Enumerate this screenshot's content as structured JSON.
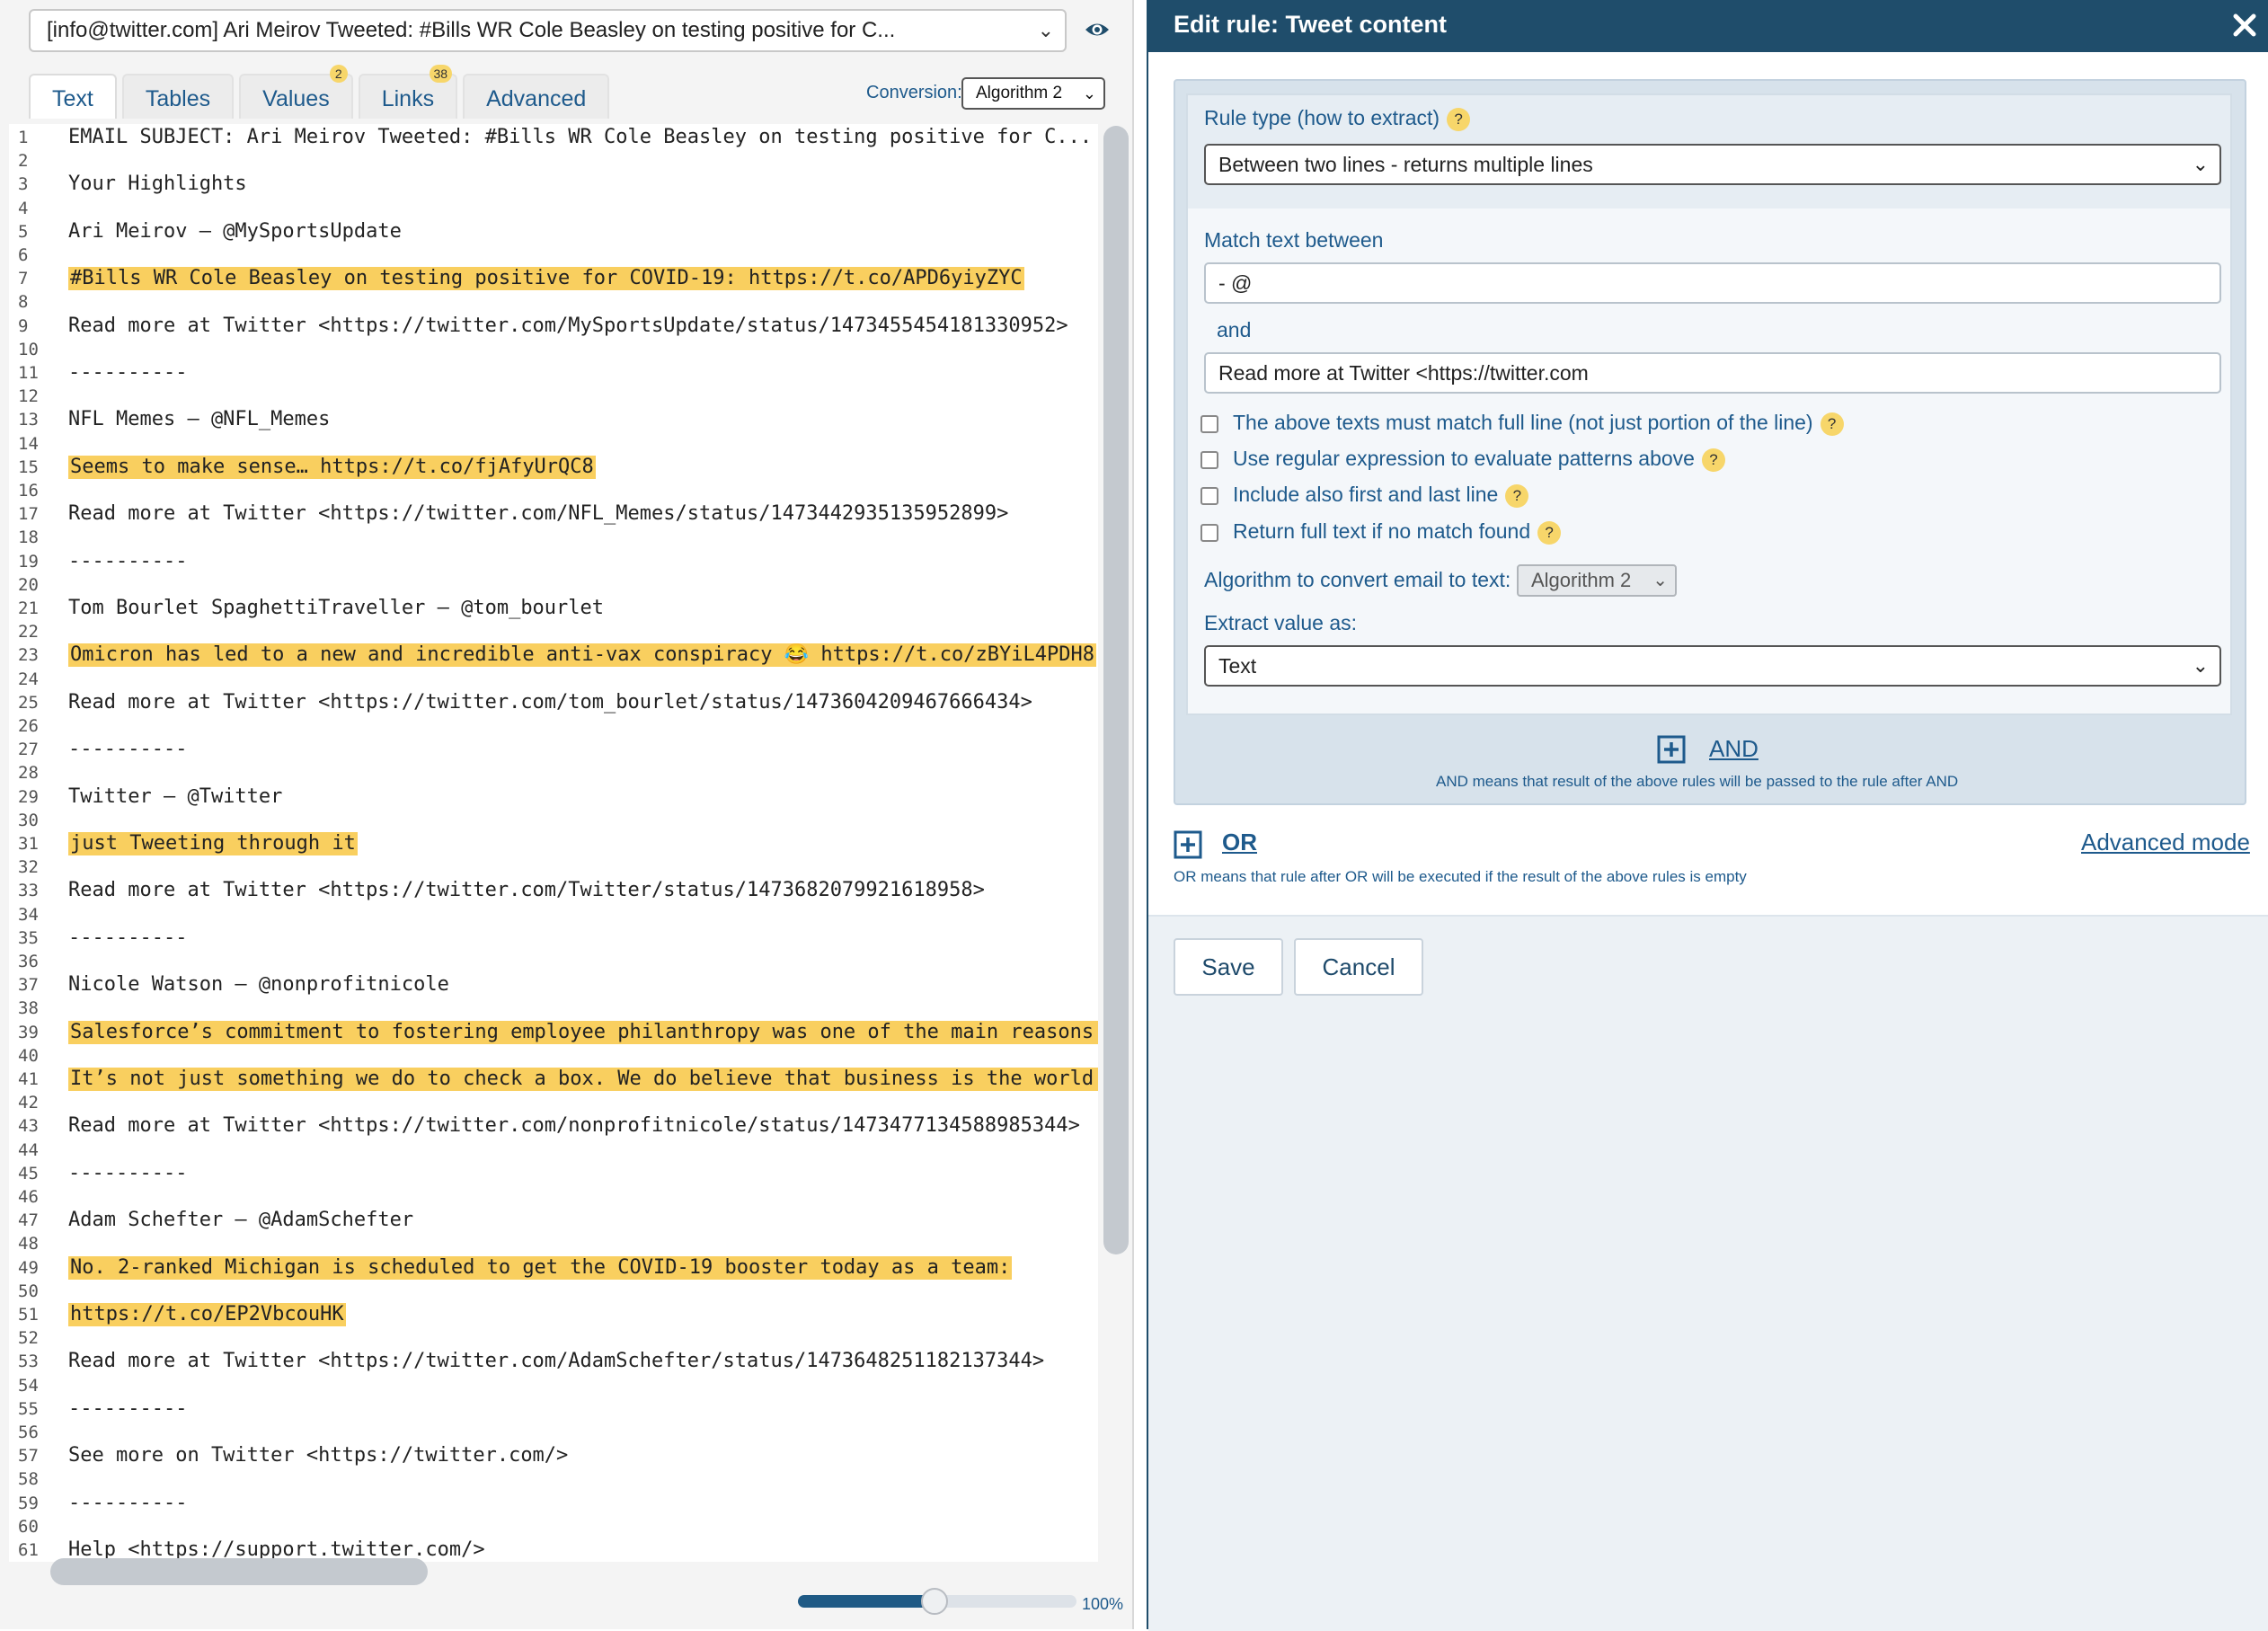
{
  "left": {
    "email_select": "[info@twitter.com] Ari Meirov Tweeted: #Bills WR Cole Beasley on testing positive for C...",
    "tabs": [
      {
        "label": "Text",
        "badge": ""
      },
      {
        "label": "Tables",
        "badge": ""
      },
      {
        "label": "Values",
        "badge": "2"
      },
      {
        "label": "Links",
        "badge": "38"
      },
      {
        "label": "Advanced",
        "badge": ""
      }
    ],
    "conversion_label": "Conversion:",
    "conversion_value": "Algorithm 2",
    "zoom_label": "100%",
    "zoom_level_percent": 50,
    "lines": [
      {
        "n": "1",
        "t": "EMAIL SUBJECT: Ari Meirov Tweeted: #Bills WR Cole Beasley on testing positive for C...",
        "hl": false
      },
      {
        "n": "2",
        "t": "",
        "hl": false
      },
      {
        "n": "3",
        "t": "Your Highlights",
        "hl": false
      },
      {
        "n": "4",
        "t": "",
        "hl": false
      },
      {
        "n": "5",
        "t": "Ari Meirov – @MySportsUpdate",
        "hl": false
      },
      {
        "n": "6",
        "t": "",
        "hl": false
      },
      {
        "n": "7",
        "t": "#Bills WR Cole Beasley on testing positive for COVID-19: https://t.co/APD6yiyZYC",
        "hl": true
      },
      {
        "n": "8",
        "t": "",
        "hl": false
      },
      {
        "n": "9",
        "t": "Read more at Twitter <https://twitter.com/MySportsUpdate/status/1473455454181330952>",
        "hl": false
      },
      {
        "n": "10",
        "t": "",
        "hl": false
      },
      {
        "n": "11",
        "t": "----------",
        "hl": false
      },
      {
        "n": "12",
        "t": "",
        "hl": false
      },
      {
        "n": "13",
        "t": "NFL Memes – @NFL_Memes",
        "hl": false
      },
      {
        "n": "14",
        "t": "",
        "hl": false
      },
      {
        "n": "15",
        "t": "Seems to make sense… https://t.co/fjAfyUrQC8",
        "hl": true
      },
      {
        "n": "16",
        "t": "",
        "hl": false
      },
      {
        "n": "17",
        "t": "Read more at Twitter <https://twitter.com/NFL_Memes/status/1473442935135952899>",
        "hl": false
      },
      {
        "n": "18",
        "t": "",
        "hl": false
      },
      {
        "n": "19",
        "t": "----------",
        "hl": false
      },
      {
        "n": "20",
        "t": "",
        "hl": false
      },
      {
        "n": "21",
        "t": "Tom Bourlet SpaghettiTraveller – @tom_bourlet",
        "hl": false
      },
      {
        "n": "22",
        "t": "",
        "hl": false
      },
      {
        "n": "23",
        "t": "Omicron has led to a new and incredible anti-vax conspiracy 😂 https://t.co/zBYiL4PDH8",
        "hl": true
      },
      {
        "n": "24",
        "t": "",
        "hl": false
      },
      {
        "n": "25",
        "t": "Read more at Twitter <https://twitter.com/tom_bourlet/status/1473604209467666434>",
        "hl": false
      },
      {
        "n": "26",
        "t": "",
        "hl": false
      },
      {
        "n": "27",
        "t": "----------",
        "hl": false
      },
      {
        "n": "28",
        "t": "",
        "hl": false
      },
      {
        "n": "29",
        "t": "Twitter – @Twitter",
        "hl": false
      },
      {
        "n": "30",
        "t": "",
        "hl": false
      },
      {
        "n": "31",
        "t": "just Tweeting through it",
        "hl": true
      },
      {
        "n": "32",
        "t": "",
        "hl": false
      },
      {
        "n": "33",
        "t": "Read more at Twitter <https://twitter.com/Twitter/status/1473682079921618958>",
        "hl": false
      },
      {
        "n": "34",
        "t": "",
        "hl": false
      },
      {
        "n": "35",
        "t": "----------",
        "hl": false
      },
      {
        "n": "36",
        "t": "",
        "hl": false
      },
      {
        "n": "37",
        "t": "Nicole Watson – @nonprofitnicole",
        "hl": false
      },
      {
        "n": "38",
        "t": "",
        "hl": false
      },
      {
        "n": "39",
        "t": "Salesforce’s commitment to fostering employee philanthropy was one of the main reasons wh",
        "hl": true
      },
      {
        "n": "40",
        "t": "",
        "hl": false
      },
      {
        "n": "41",
        "t": "It’s not just something we do to check a box. We do believe that business is the world’s",
        "hl": true
      },
      {
        "n": "42",
        "t": "",
        "hl": false
      },
      {
        "n": "43",
        "t": "Read more at Twitter <https://twitter.com/nonprofitnicole/status/1473477134588985344>",
        "hl": false
      },
      {
        "n": "44",
        "t": "",
        "hl": false
      },
      {
        "n": "45",
        "t": "----------",
        "hl": false
      },
      {
        "n": "46",
        "t": "",
        "hl": false
      },
      {
        "n": "47",
        "t": "Adam Schefter – @AdamSchefter",
        "hl": false
      },
      {
        "n": "48",
        "t": "",
        "hl": false
      },
      {
        "n": "49",
        "t": "No. 2-ranked Michigan is scheduled to get the COVID-19 booster today as a team:",
        "hl": true
      },
      {
        "n": "50",
        "t": "",
        "hl": false
      },
      {
        "n": "51",
        "t": "https://t.co/EP2VbcouHK",
        "hl": true
      },
      {
        "n": "52",
        "t": "",
        "hl": false
      },
      {
        "n": "53",
        "t": "Read more at Twitter <https://twitter.com/AdamSchefter/status/1473648251182137344>",
        "hl": false
      },
      {
        "n": "54",
        "t": "",
        "hl": false
      },
      {
        "n": "55",
        "t": "----------",
        "hl": false
      },
      {
        "n": "56",
        "t": "",
        "hl": false
      },
      {
        "n": "57",
        "t": "See more on Twitter <https://twitter.com/>",
        "hl": false
      },
      {
        "n": "58",
        "t": "",
        "hl": false
      },
      {
        "n": "59",
        "t": "----------",
        "hl": false
      },
      {
        "n": "60",
        "t": "",
        "hl": false
      },
      {
        "n": "61",
        "t": "Help <https://support.twitter.com/>",
        "hl": false
      },
      {
        "n": "62",
        "t": "",
        "hl": false
      }
    ]
  },
  "right": {
    "title": "Edit rule: Tweet content",
    "rule_type_label": "Rule type (how to extract)",
    "rule_type_value": "Between two lines - returns multiple lines",
    "match_label": "Match text between",
    "match_start": "- @",
    "and_label": "and",
    "match_end": "Read more at Twitter <https://twitter.com",
    "checkboxes": [
      {
        "label": "The above texts must match full line (not just portion of the line)",
        "checked": false
      },
      {
        "label": "Use regular expression to evaluate patterns above",
        "checked": false
      },
      {
        "label": "Include also first and last line",
        "checked": false
      },
      {
        "label": "Return full text if no match found",
        "checked": false
      }
    ],
    "algorithm_label": "Algorithm to convert email to text:",
    "algorithm_value": "Algorithm 2",
    "extract_label": "Extract value as:",
    "extract_value": "Text",
    "and_link": "AND",
    "and_note": "AND means that result of the above rules will be passed to the rule after AND",
    "or_link": "OR",
    "or_note": "OR means that rule after OR will be executed if the result of the above rules is empty",
    "advanced_mode": "Advanced mode",
    "save": "Save",
    "cancel": "Cancel",
    "help_glyph": "?"
  },
  "colors": {
    "header": "#1f4d6b",
    "highlight": "#f9cf5f",
    "link": "#1e5a8c",
    "help_badge": "#f7d66a"
  }
}
